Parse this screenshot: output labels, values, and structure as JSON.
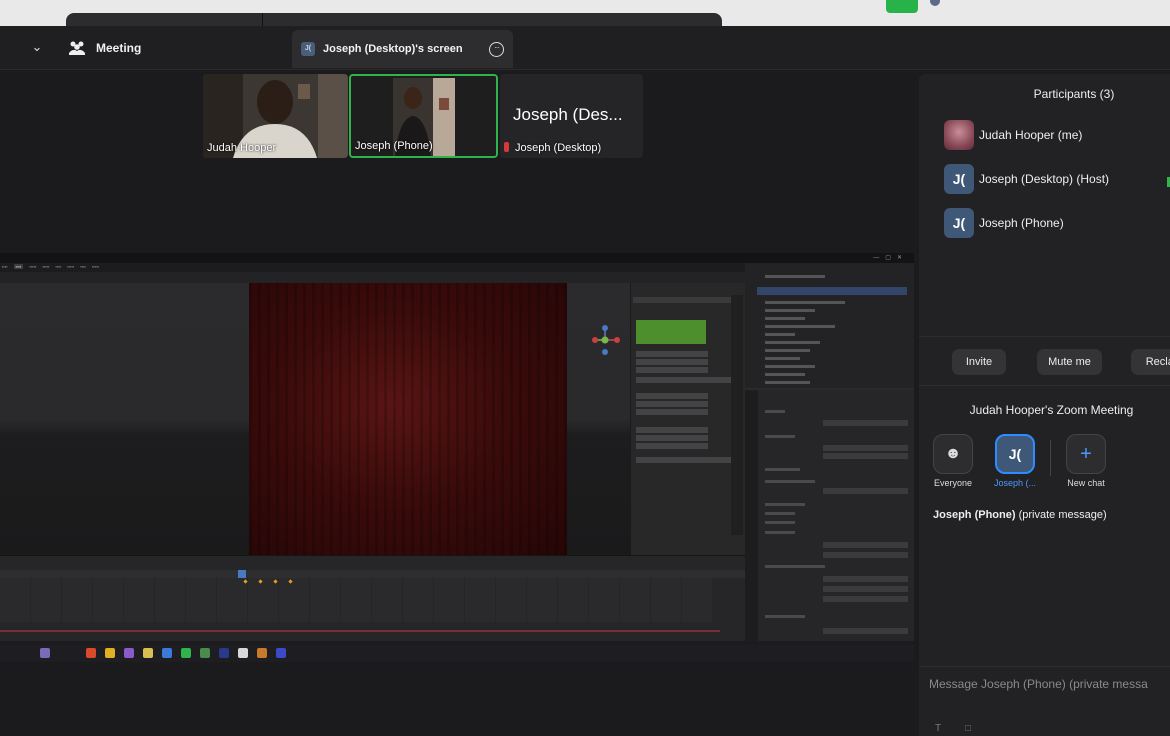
{
  "header": {
    "meeting_label": "Meeting",
    "share_tab_avatar": "J(",
    "share_tab_title": "Joseph (Desktop)'s screen"
  },
  "tiles": [
    {
      "name": "Judah Hooper"
    },
    {
      "name": "Joseph (Phone)"
    },
    {
      "name": "Joseph (Desktop)",
      "display_name": "Joseph (Des..."
    }
  ],
  "participants": {
    "title": "Participants (3)",
    "items": [
      {
        "name": "Judah Hooper (me)",
        "avatar": ""
      },
      {
        "name": "Joseph (Desktop) (Host)",
        "avatar": "J("
      },
      {
        "name": "Joseph (Phone)",
        "avatar": "J("
      }
    ],
    "buttons": [
      "Invite",
      "Mute me",
      "Reclai"
    ]
  },
  "chat": {
    "title": "Judah Hooper's Zoom Meeting",
    "recipients": [
      {
        "label": "Everyone",
        "glyph": "☻"
      },
      {
        "label": "Joseph (...",
        "glyph": "J("
      },
      {
        "label": "New chat",
        "glyph": "+"
      }
    ],
    "pm_name": "Joseph (Phone)",
    "pm_suffix": "(private message)",
    "input_placeholder": "Message Joseph (Phone) (private messa",
    "tool_text": "T"
  },
  "colors": {
    "accent_blue": "#2d8cff",
    "speaker_green": "#2fb34b",
    "avatar_blue": "#3f5878"
  }
}
